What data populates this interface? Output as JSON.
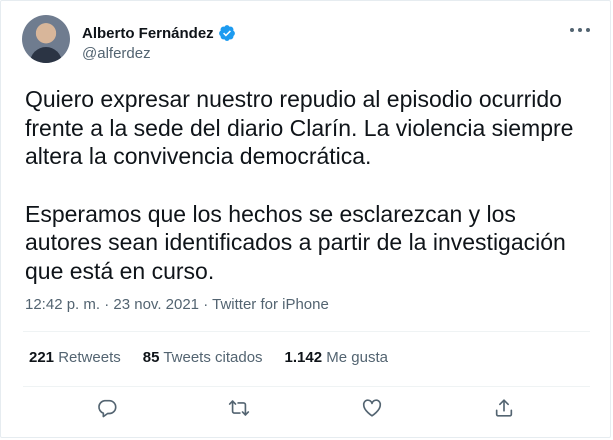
{
  "author": {
    "display_name": "Alberto Fernández",
    "handle": "@alferdez",
    "verified_icon": "verified-badge-icon",
    "avatar_icon": "profile-photo"
  },
  "tweet": {
    "paragraphs": [
      "Quiero expresar nuestro repudio al episodio ocurrido frente a la sede del diario Clarín. La violencia siempre altera la convivencia democrática.",
      "Esperamos que los hechos se esclarezcan y los autores sean identificados a partir de la investigación que está en curso."
    ],
    "time": "12:42 p. m.",
    "separator": "·",
    "date": "23 nov. 2021",
    "source": "Twitter for iPhone"
  },
  "stats": {
    "retweets_count": "221",
    "retweets_label": "Retweets",
    "quotes_count": "85",
    "quotes_label": "Tweets citados",
    "likes_count": "1.142",
    "likes_label": "Me gusta"
  },
  "actions": [
    "reply-icon",
    "retweet-icon",
    "like-icon",
    "share-icon"
  ],
  "colors": {
    "verified": "#1d9bf0",
    "text": "#0f1419",
    "secondary": "#536471",
    "divider": "#eff3f4"
  }
}
